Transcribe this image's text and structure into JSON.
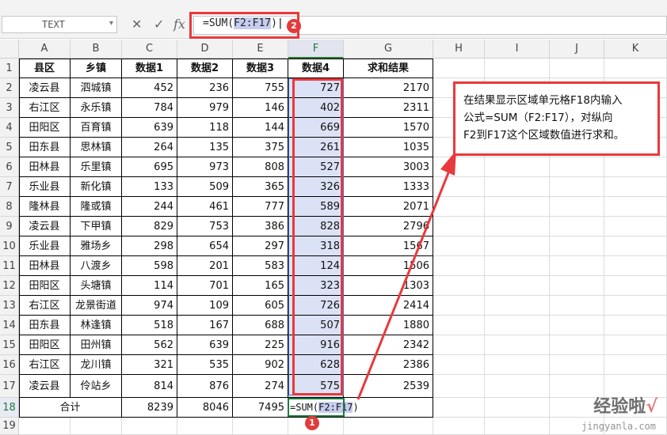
{
  "name_box": {
    "value": "TEXT"
  },
  "formula_bar": {
    "fx_label": "fx",
    "formula_prefix": "=SUM(",
    "formula_ref": "F2:F17",
    "formula_suffix": ")"
  },
  "columns": [
    "A",
    "B",
    "C",
    "D",
    "E",
    "F",
    "G",
    "H",
    "I",
    "J",
    "K"
  ],
  "rows": [
    "1",
    "2",
    "3",
    "4",
    "5",
    "6",
    "7",
    "8",
    "9",
    "10",
    "11",
    "12",
    "13",
    "14",
    "15",
    "16",
    "17",
    "18",
    "19"
  ],
  "headers": [
    "县区",
    "乡镇",
    "数据1",
    "数据2",
    "数据3",
    "数据4",
    "求和结果"
  ],
  "table": [
    [
      "凌云县",
      "泗城镇",
      "452",
      "236",
      "755",
      "727",
      "2170"
    ],
    [
      "右江区",
      "永乐镇",
      "784",
      "979",
      "146",
      "402",
      "2311"
    ],
    [
      "田阳区",
      "百育镇",
      "639",
      "118",
      "144",
      "669",
      "1570"
    ],
    [
      "田东县",
      "思林镇",
      "264",
      "135",
      "375",
      "261",
      "1035"
    ],
    [
      "田林县",
      "乐里镇",
      "695",
      "973",
      "808",
      "527",
      "3003"
    ],
    [
      "乐业县",
      "新化镇",
      "133",
      "509",
      "365",
      "326",
      "1333"
    ],
    [
      "隆林县",
      "隆或镇",
      "244",
      "461",
      "777",
      "589",
      "2071"
    ],
    [
      "凌云县",
      "下甲镇",
      "829",
      "753",
      "386",
      "828",
      "2796"
    ],
    [
      "乐业县",
      "雅场乡",
      "298",
      "654",
      "297",
      "318",
      "1567"
    ],
    [
      "田林县",
      "八渡乡",
      "598",
      "201",
      "583",
      "124",
      "1506"
    ],
    [
      "田阳区",
      "头塘镇",
      "114",
      "701",
      "165",
      "323",
      "1303"
    ],
    [
      "右江区",
      "龙景街道",
      "974",
      "109",
      "605",
      "726",
      "2414"
    ],
    [
      "田东县",
      "林逢镇",
      "518",
      "167",
      "688",
      "507",
      "1880"
    ],
    [
      "田阳区",
      "田州镇",
      "562",
      "639",
      "225",
      "916",
      "2342"
    ],
    [
      "右江区",
      "龙川镇",
      "321",
      "535",
      "902",
      "628",
      "2386"
    ],
    [
      "凌云县",
      "伶站乡",
      "814",
      "876",
      "274",
      "575",
      "2539"
    ]
  ],
  "total_row": {
    "label": "合计",
    "c": "8239",
    "d": "8046",
    "e": "7495",
    "f_prefix": "=SUM(",
    "f_ref": "F2:F17",
    "f_suffix": ")"
  },
  "callout": {
    "line1": "在结果显示区域单元格F18内输入",
    "line2": "公式=SUM（F2:F17），对纵向",
    "line3": "F2到F17这个区域数值进行求和。"
  },
  "markers": {
    "m1": "1",
    "m2": "2"
  },
  "watermark": {
    "title": "经验啦",
    "check": "√",
    "url": "jingyanla.com"
  },
  "colors": {
    "highlight_red": "#e8393c",
    "range_blue": "#dce2f5",
    "selection_green": "#1f7a3e"
  }
}
